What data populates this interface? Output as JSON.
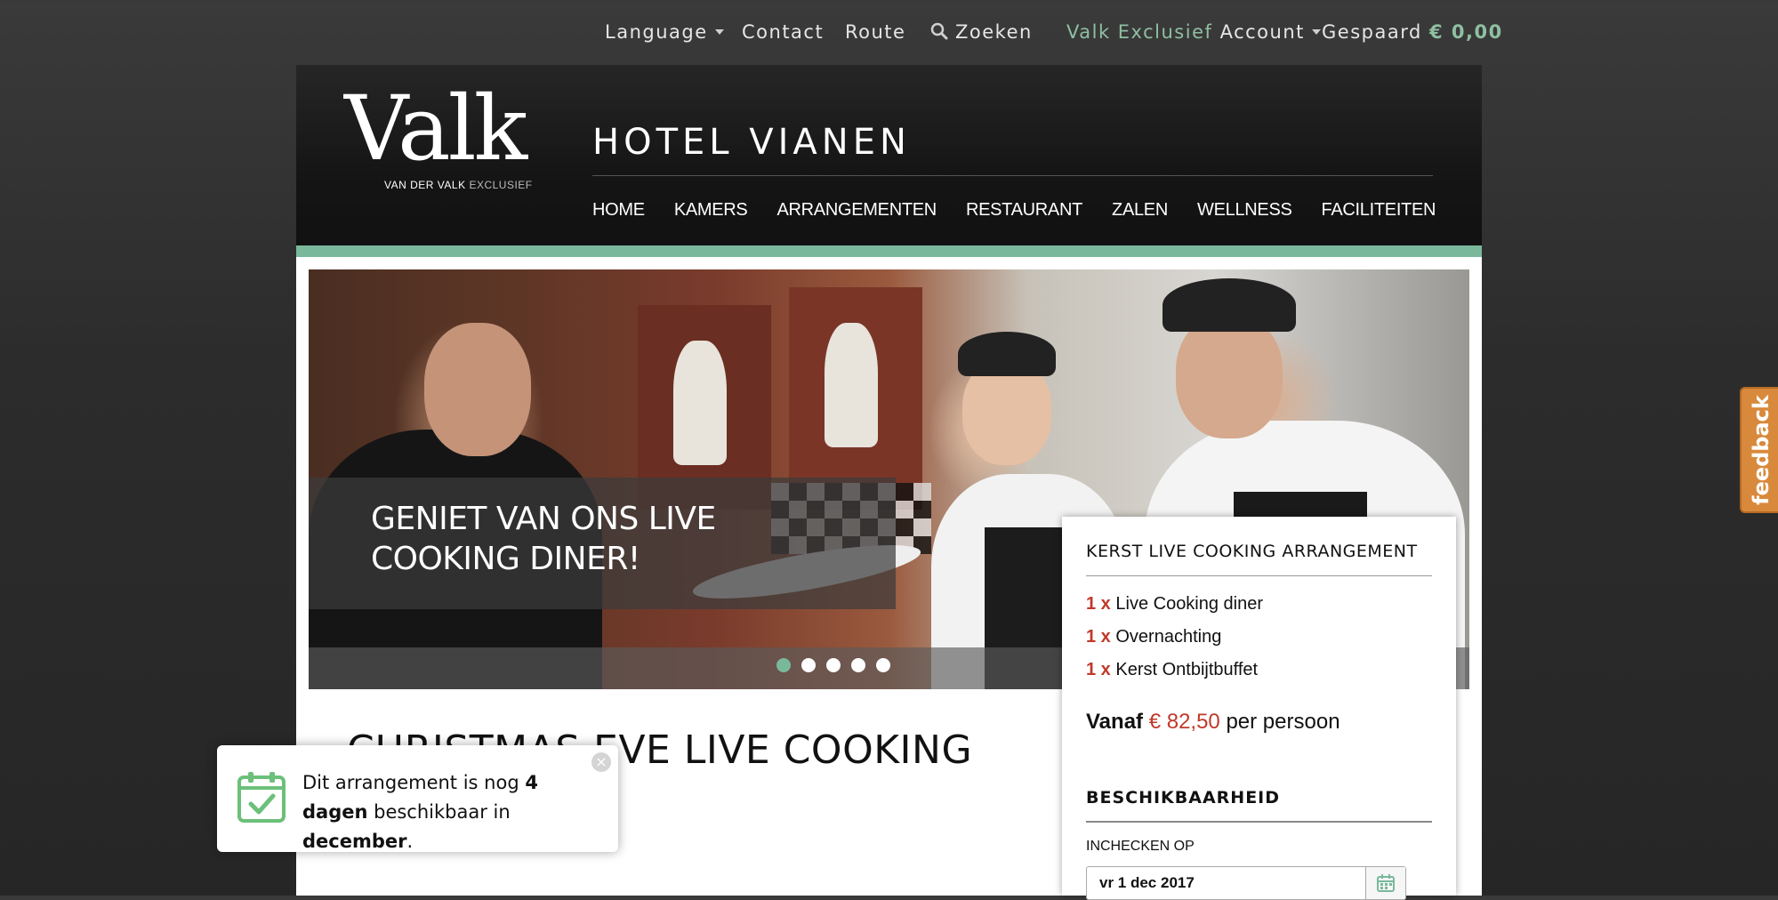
{
  "topbar": {
    "language": "Language",
    "contact": "Contact",
    "route": "Route",
    "search": "Zoeken",
    "exclusief": "Valk Exclusief",
    "account": "Account",
    "saved_label": "Gespaard",
    "saved_amount": "€ 0,00"
  },
  "header": {
    "logo_main": "Valk",
    "logo_sub": "VAN DER VALK",
    "logo_sub2": "EXCLUSIEF",
    "hotel_name": "HOTEL VIANEN",
    "nav": [
      "HOME",
      "KAMERS",
      "ARRANGEMENTEN",
      "RESTAURANT",
      "ZALEN",
      "WELLNESS",
      "FACILITEITEN"
    ]
  },
  "hero": {
    "caption_line1": "GENIET VAN ONS LIVE",
    "caption_line2": "COOKING DINER!",
    "slide_count": 5,
    "active_slide": 1
  },
  "package": {
    "title": "KERST LIVE COOKING ARRANGEMENT",
    "items": [
      {
        "qty": "1 x",
        "name": "Live Cooking diner"
      },
      {
        "qty": "1 x",
        "name": "Overnachting"
      },
      {
        "qty": "1 x",
        "name": "Kerst Ontbijtbuffet"
      }
    ],
    "price_prefix": "Vanaf",
    "price_amount": "€ 82,50",
    "price_suffix": "per persoon",
    "availability_title": "BESCHIKBAARHEID",
    "checkin_label": "INCHECKEN OP",
    "checkin_value": "vr 1 dec 2017"
  },
  "page_title": "CHRISTMAS EVE LIVE COOKING",
  "toast": {
    "text1": "Dit arrangement is nog ",
    "bold1": "4 dagen",
    "text2": " beschikbaar in ",
    "bold2": "december",
    "text3": ".",
    "close": "×"
  },
  "feedback": "feedback",
  "colors": {
    "accent_green": "#7ab89b",
    "price_red": "#c0392b",
    "feedback_orange": "#d9893b"
  }
}
